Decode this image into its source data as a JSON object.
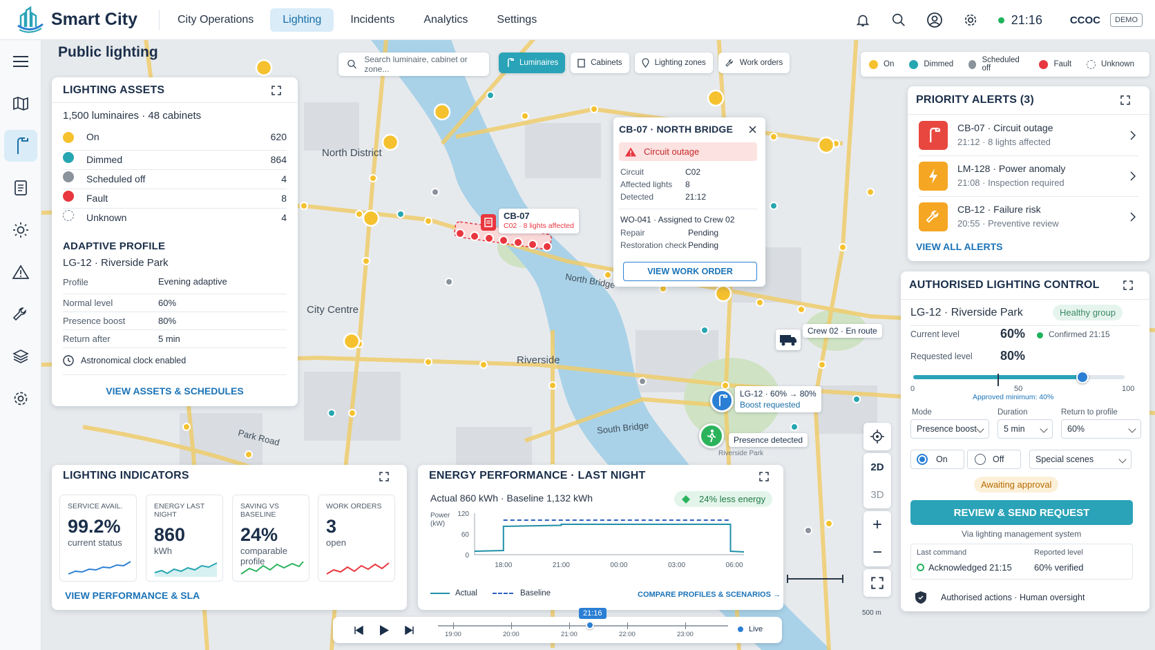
{
  "app": {
    "title": "Smart City",
    "org": "CCOC",
    "mode_badge": "DEMO",
    "time": "21:16"
  },
  "nav": [
    "City Operations",
    "Lighting",
    "Incidents",
    "Analytics",
    "Settings"
  ],
  "page_title": "Public lighting",
  "search": {
    "placeholder": "Search luminaire, cabinet or zone..."
  },
  "layer_tabs": [
    "Luminaires",
    "Cabinets",
    "Lighting zones",
    "Work orders"
  ],
  "legend": [
    {
      "label": "On",
      "color": "#f5c12e"
    },
    {
      "label": "Dimmed",
      "color": "#26a6b0"
    },
    {
      "label": "Scheduled off",
      "color": "#8a939c"
    },
    {
      "label": "Fault",
      "color": "#e8373f"
    },
    {
      "label": "Unknown",
      "color": "#ffffff"
    }
  ],
  "assets": {
    "title": "LIGHTING ASSETS",
    "summary": "1,500 luminaires · 48 cabinets",
    "rows": [
      {
        "label": "On",
        "value": "620",
        "color": "#f5c12e"
      },
      {
        "label": "Dimmed",
        "value": "864",
        "color": "#26a6b0"
      },
      {
        "label": "Scheduled off",
        "value": "4",
        "color": "#8a939c"
      },
      {
        "label": "Fault",
        "value": "8",
        "color": "#e8373f"
      },
      {
        "label": "Unknown",
        "value": "4",
        "color": "#ffffff"
      }
    ],
    "profile_title": "ADAPTIVE PROFILE",
    "profile_name": "LG-12 · Riverside Park",
    "profile_rows": [
      {
        "label": "Profile",
        "value": "Evening adaptive"
      },
      {
        "label": "Normal level",
        "value": "60%"
      },
      {
        "label": "Presence boost",
        "value": "80%"
      },
      {
        "label": "Return after",
        "value": "5 min"
      }
    ],
    "clock_note": "Astronomical clock enabled",
    "link": "VIEW ASSETS & SCHEDULES"
  },
  "map_labels": {
    "north_district": "North District",
    "city_centre": "City Centre",
    "riverside": "Riverside",
    "north_bridge": "North Bridge",
    "south_bridge": "South Bridge",
    "park_road": "Park Road",
    "riverside_park": "Riverside Park",
    "scale": "500 m"
  },
  "map_callouts": {
    "cb07_title": "CB-07",
    "cb07_sub": "C02 · 8 lights affected",
    "crew": "Crew 02 · En route",
    "lg12_title": "LG-12 · 60% → 80%",
    "lg12_sub": "Boost requested",
    "presence": "Presence detected"
  },
  "popup": {
    "title": "CB-07 · NORTH BRIDGE",
    "status": "Circuit outage",
    "rows": [
      {
        "label": "Circuit",
        "value": "C02"
      },
      {
        "label": "Affected lights",
        "value": "8"
      },
      {
        "label": "Detected",
        "value": "21:12"
      }
    ],
    "wo": "WO-041 · Assigned to Crew 02",
    "wo_rows": [
      {
        "label": "Repair",
        "value": "Pending"
      },
      {
        "label": "Restoration check",
        "value": "Pending"
      }
    ],
    "button": "VIEW WORK ORDER"
  },
  "alerts": {
    "title": "PRIORITY ALERTS (3)",
    "items": [
      {
        "title": "CB-07 · Circuit outage",
        "sub": "21:12 · 8 lights affected",
        "color": "#e8473f"
      },
      {
        "title": "LM-128 · Power anomaly",
        "sub": "21:08 · Inspection required",
        "color": "#f5a623"
      },
      {
        "title": "CB-12 · Failure risk",
        "sub": "20:55 · Preventive review",
        "color": "#f5a623"
      }
    ],
    "link": "VIEW ALL ALERTS"
  },
  "control": {
    "title": "AUTHORISED LIGHTING CONTROL",
    "group": "LG-12 · Riverside Park",
    "health": "Healthy group",
    "current_label": "Current level",
    "current_value": "60%",
    "confirmed": "Confirmed 21:15",
    "requested_label": "Requested level",
    "requested_value": "80%",
    "slider": {
      "min_label": "0",
      "mid_label": "50",
      "max_label": "100",
      "value": 80,
      "min_allowed": 40
    },
    "approved_min": "Approved minimum: 40%",
    "mode_label": "Mode",
    "mode_value": "Presence boost",
    "duration_label": "Duration",
    "duration_value": "5 min",
    "return_label": "Return to profile",
    "return_value": "60%",
    "on_label": "On",
    "off_label": "Off",
    "scenes": "Special scenes",
    "status": "Awaiting approval",
    "button": "REVIEW & SEND REQUEST",
    "via": "Via lighting management system",
    "last_cmd_label": "Last command",
    "last_cmd_value": "Acknowledged 21:15",
    "reported_label": "Reported level",
    "reported_value": "60% verified",
    "footer": "Authorised actions · Human oversight"
  },
  "indicators": {
    "title": "LIGHTING INDICATORS",
    "cards": [
      {
        "label": "SERVICE AVAIL.",
        "value": "99.2%",
        "sub": "current status",
        "color": "#2a7fd4"
      },
      {
        "label": "ENERGY LAST NIGHT",
        "value": "860",
        "sub": "kWh",
        "color": "#26a6b0"
      },
      {
        "label": "SAVING VS BASELINE",
        "value": "24%",
        "sub": "comparable profile",
        "color": "#2bb35c"
      },
      {
        "label": "WORK ORDERS",
        "value": "3",
        "sub": "open",
        "color": "#e8373f"
      }
    ],
    "link": "VIEW PERFORMANCE & SLA"
  },
  "energy": {
    "title": "ENERGY PERFORMANCE · LAST NIGHT",
    "summary": "Actual  860 kWh · Baseline 1,132 kWh",
    "badge": "24% less energy",
    "link": "COMPARE PROFILES & SCENARIOS →"
  },
  "chart_data": {
    "type": "line",
    "ylabel": "Power (kW)",
    "ylim": [
      0,
      120
    ],
    "yticks": [
      "120",
      "60",
      "0"
    ],
    "xticks": [
      "18:00",
      "21:00",
      "00:00",
      "03:00",
      "06:00"
    ],
    "series": [
      {
        "name": "Actual",
        "color": "#1f8fa8",
        "x": [
          16.5,
          18.0,
          18.0,
          21.0,
          21.0,
          5.8,
          5.8,
          6.5
        ],
        "y": [
          10,
          12,
          82,
          85,
          88,
          88,
          10,
          8
        ]
      },
      {
        "name": "Baseline",
        "color": "#2a5fc0",
        "x": [
          18.0,
          5.8
        ],
        "y": [
          100,
          100
        ]
      }
    ]
  },
  "timeline": {
    "time": "21:16",
    "ticks": [
      "19:00",
      "20:00",
      "21:00",
      "22:00",
      "23:00"
    ],
    "live": "Live"
  },
  "map_tools": {
    "two_d": "2D",
    "three_d": "3D",
    "plus": "+",
    "minus": "−"
  }
}
